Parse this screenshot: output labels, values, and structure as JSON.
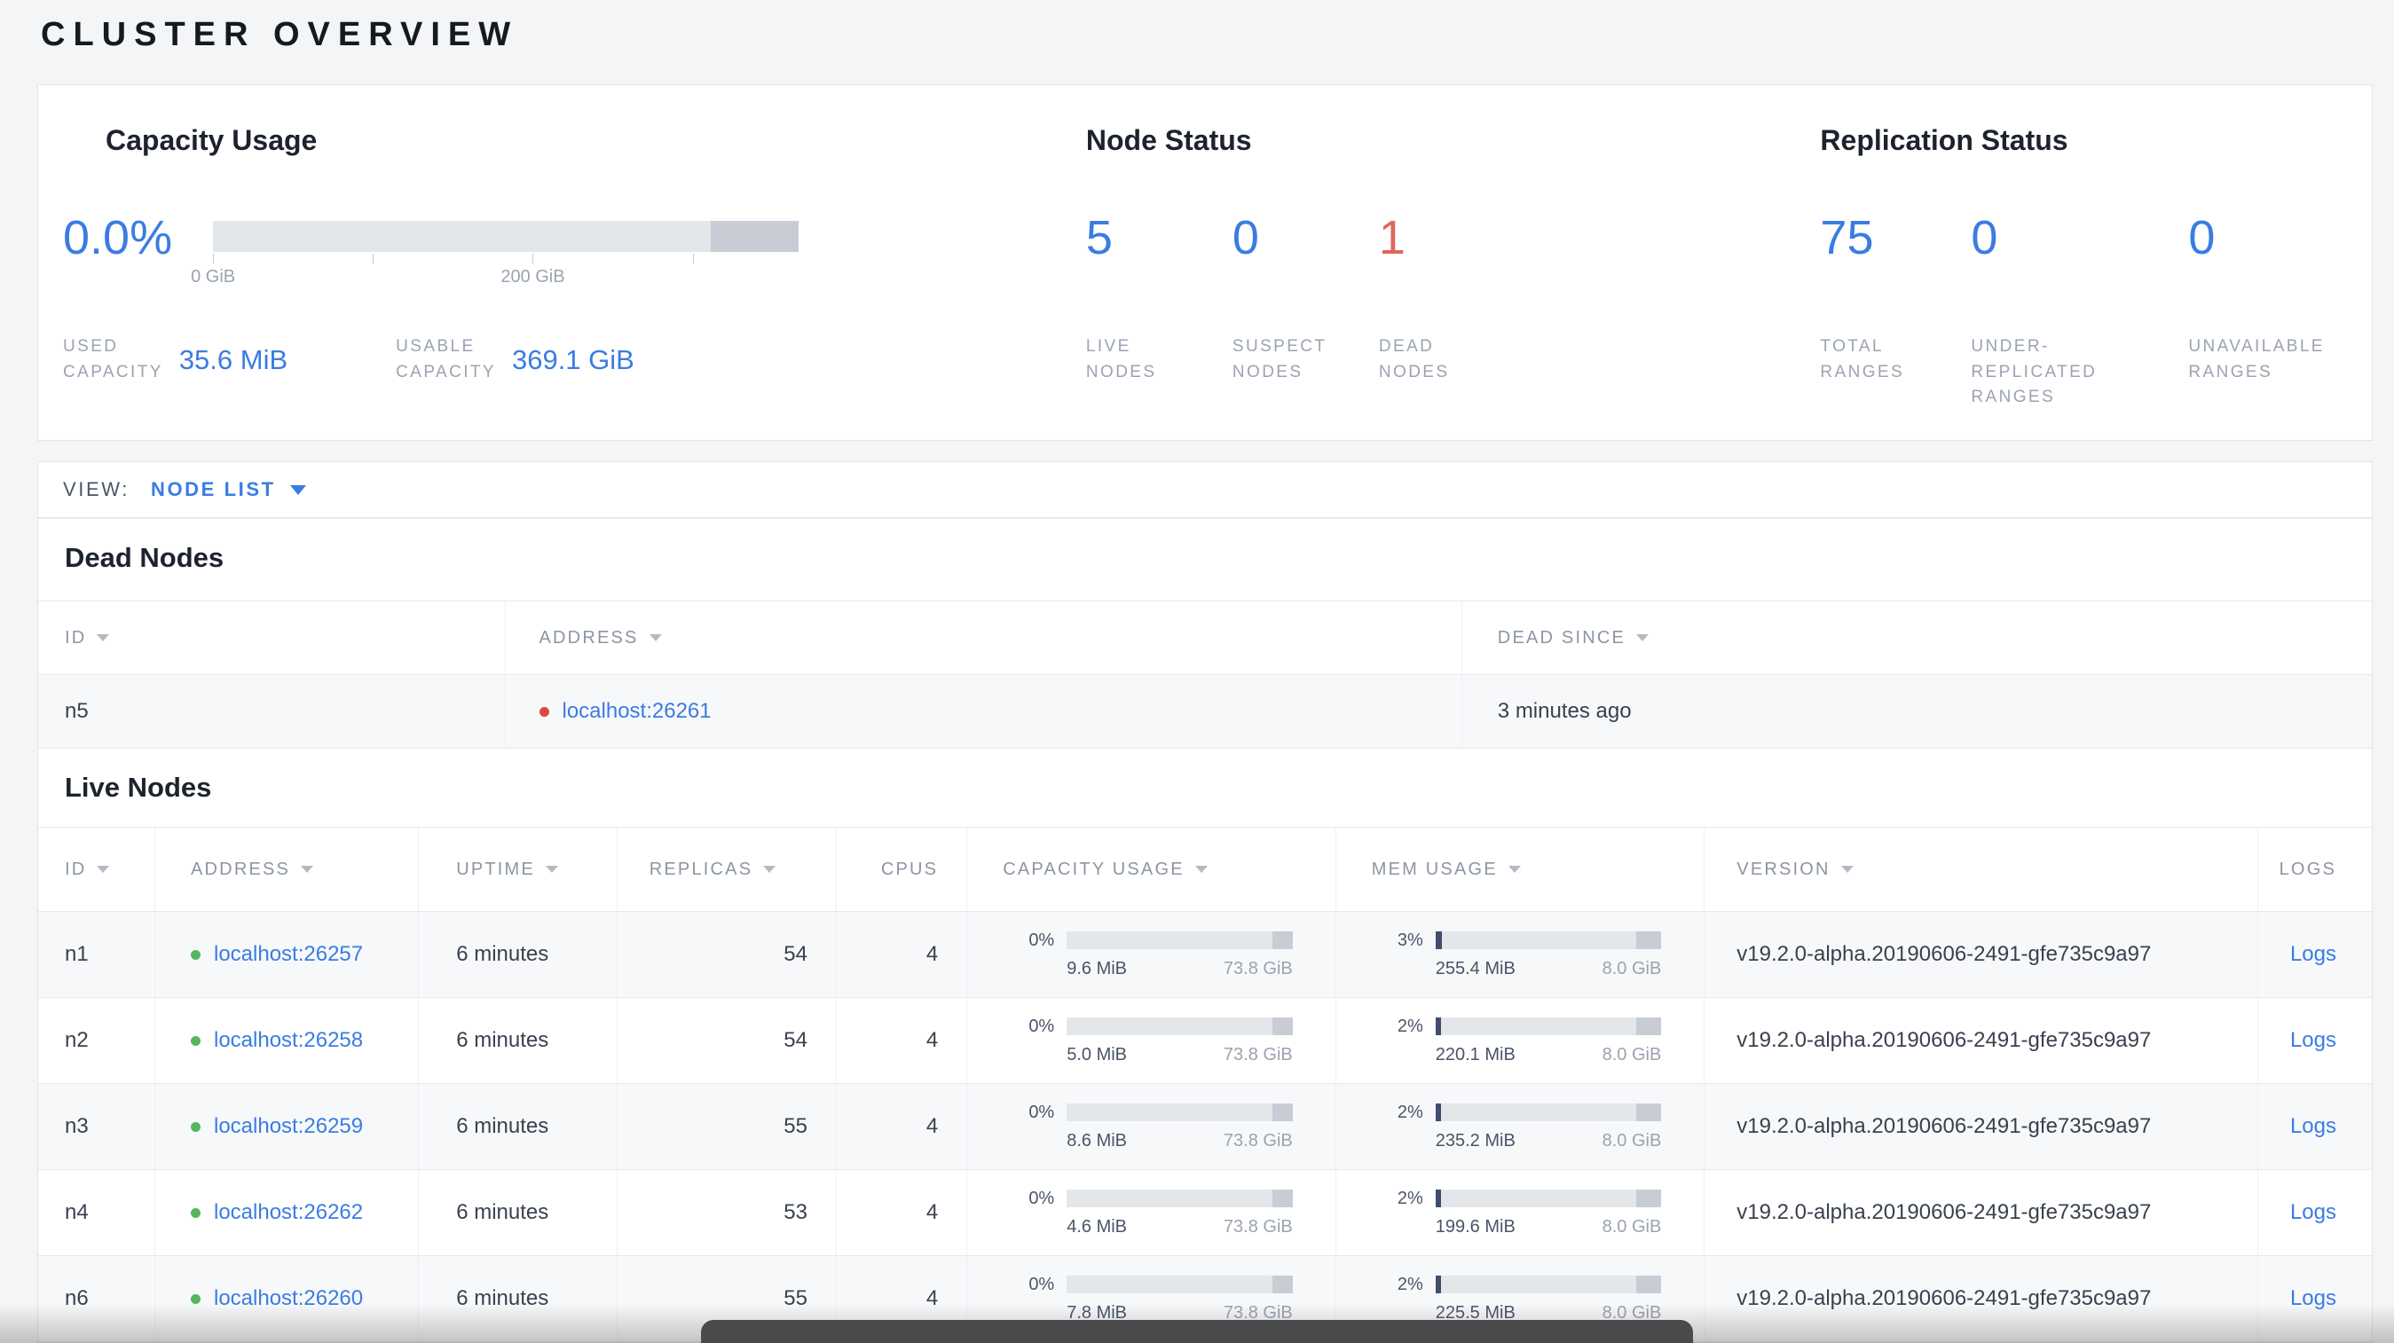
{
  "page": {
    "title": "CLUSTER OVERVIEW"
  },
  "summary": {
    "capacity": {
      "heading": "Capacity Usage",
      "percent": "0.0%",
      "bar": {
        "used_pct": 0,
        "other_start_pct": 85,
        "ticks": [
          {
            "pct": 0,
            "label": "0 GiB"
          },
          {
            "pct": 27.3,
            "label": ""
          },
          {
            "pct": 54.6,
            "label": "200 GiB"
          },
          {
            "pct": 81.9,
            "label": ""
          }
        ]
      },
      "used": {
        "label": "USED\nCAPACITY",
        "value": "35.6 MiB"
      },
      "usable": {
        "label": "USABLE\nCAPACITY",
        "value": "369.1 GiB"
      }
    },
    "node_status": {
      "heading": "Node Status",
      "stats": [
        {
          "value": "5",
          "label": "LIVE\nNODES"
        },
        {
          "value": "0",
          "label": "SUSPECT\nNODES"
        },
        {
          "value": "1",
          "label": "DEAD\nNODES"
        }
      ]
    },
    "replication": {
      "heading": "Replication Status",
      "stats": [
        {
          "value": "75",
          "label": "TOTAL\nRANGES"
        },
        {
          "value": "0",
          "label": "UNDER-\nREPLICATED\nRANGES"
        },
        {
          "value": "0",
          "label": "UNAVAILABLE\nRANGES"
        }
      ]
    }
  },
  "view_bar": {
    "label": "VIEW:",
    "selected": "NODE LIST"
  },
  "dead_nodes": {
    "heading": "Dead Nodes",
    "columns": [
      {
        "label": "ID",
        "sortable": true
      },
      {
        "label": "ADDRESS",
        "sortable": true
      },
      {
        "label": "DEAD SINCE",
        "sortable": true
      }
    ],
    "rows": [
      {
        "id": "n5",
        "address": "localhost:26261",
        "dead_since": "3 minutes ago"
      }
    ]
  },
  "live_nodes": {
    "heading": "Live Nodes",
    "columns": [
      {
        "label": "ID",
        "sortable": true
      },
      {
        "label": "ADDRESS",
        "sortable": true
      },
      {
        "label": "UPTIME",
        "sortable": true
      },
      {
        "label": "REPLICAS",
        "sortable": true
      },
      {
        "label": "CPUS",
        "sortable": false
      },
      {
        "label": "CAPACITY USAGE",
        "sortable": true
      },
      {
        "label": "MEM USAGE",
        "sortable": true
      },
      {
        "label": "VERSION",
        "sortable": true
      },
      {
        "label": "LOGS",
        "sortable": false
      }
    ],
    "rows": [
      {
        "id": "n1",
        "address": "localhost:26257",
        "uptime": "6 minutes",
        "replicas": "54",
        "cpus": "4",
        "capacity": {
          "percent": "0%",
          "used": "9.6 MiB",
          "total": "73.8 GiB",
          "used_pct": 0,
          "tail_pct": 9
        },
        "mem": {
          "percent": "3%",
          "used": "255.4 MiB",
          "total": "8.0 GiB",
          "used_pct": 3,
          "tail_pct": 11
        },
        "version": "v19.2.0-alpha.20190606-2491-gfe735c9a97",
        "logs": "Logs"
      },
      {
        "id": "n2",
        "address": "localhost:26258",
        "uptime": "6 minutes",
        "replicas": "54",
        "cpus": "4",
        "capacity": {
          "percent": "0%",
          "used": "5.0 MiB",
          "total": "73.8 GiB",
          "used_pct": 0,
          "tail_pct": 9
        },
        "mem": {
          "percent": "2%",
          "used": "220.1 MiB",
          "total": "8.0 GiB",
          "used_pct": 2,
          "tail_pct": 11
        },
        "version": "v19.2.0-alpha.20190606-2491-gfe735c9a97",
        "logs": "Logs"
      },
      {
        "id": "n3",
        "address": "localhost:26259",
        "uptime": "6 minutes",
        "replicas": "55",
        "cpus": "4",
        "capacity": {
          "percent": "0%",
          "used": "8.6 MiB",
          "total": "73.8 GiB",
          "used_pct": 0,
          "tail_pct": 9
        },
        "mem": {
          "percent": "2%",
          "used": "235.2 MiB",
          "total": "8.0 GiB",
          "used_pct": 2,
          "tail_pct": 11
        },
        "version": "v19.2.0-alpha.20190606-2491-gfe735c9a97",
        "logs": "Logs"
      },
      {
        "id": "n4",
        "address": "localhost:26262",
        "uptime": "6 minutes",
        "replicas": "53",
        "cpus": "4",
        "capacity": {
          "percent": "0%",
          "used": "4.6 MiB",
          "total": "73.8 GiB",
          "used_pct": 0,
          "tail_pct": 9
        },
        "mem": {
          "percent": "2%",
          "used": "199.6 MiB",
          "total": "8.0 GiB",
          "used_pct": 2,
          "tail_pct": 11
        },
        "version": "v19.2.0-alpha.20190606-2491-gfe735c9a97",
        "logs": "Logs"
      },
      {
        "id": "n6",
        "address": "localhost:26260",
        "uptime": "6 minutes",
        "replicas": "55",
        "cpus": "4",
        "capacity": {
          "percent": "0%",
          "used": "7.8 MiB",
          "total": "73.8 GiB",
          "used_pct": 0,
          "tail_pct": 9
        },
        "mem": {
          "percent": "2%",
          "used": "225.5 MiB",
          "total": "8.0 GiB",
          "used_pct": 2,
          "tail_pct": 11
        },
        "version": "v19.2.0-alpha.20190606-2491-gfe735c9a97",
        "logs": "Logs"
      }
    ]
  }
}
